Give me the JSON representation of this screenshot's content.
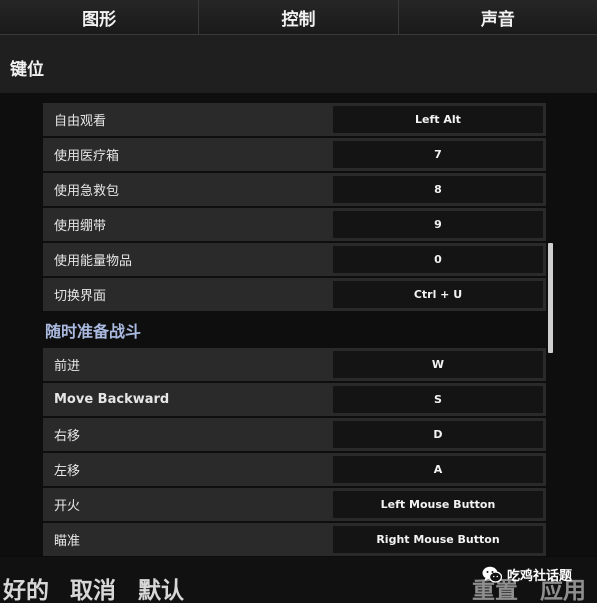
{
  "tabs": [
    {
      "label": "图形"
    },
    {
      "label": "控制"
    },
    {
      "label": "声音"
    }
  ],
  "section": {
    "title": "键位"
  },
  "rows_group1": [
    {
      "label": "自由观看",
      "key": "Left Alt"
    },
    {
      "label": "使用医疗箱",
      "key": "7"
    },
    {
      "label": "使用急救包",
      "key": "8"
    },
    {
      "label": "使用绷带",
      "key": "9"
    },
    {
      "label": "使用能量物品",
      "key": "0"
    },
    {
      "label": "切换界面",
      "key": "Ctrl + U"
    }
  ],
  "category": {
    "title": "随时准备战斗"
  },
  "rows_group2": [
    {
      "label": "前进",
      "key": "W"
    },
    {
      "label": "Move Backward",
      "key": "S"
    },
    {
      "label": "右移",
      "key": "D"
    },
    {
      "label": "左移",
      "key": "A"
    },
    {
      "label": "开火",
      "key": "Left Mouse Button"
    },
    {
      "label": "瞄准",
      "key": "Right Mouse Button"
    }
  ],
  "bottom": {
    "ok": "好的",
    "cancel": "取消",
    "default": "默认",
    "reset": "重置",
    "apply": "应用"
  },
  "watermark": {
    "text": "吃鸡社话题",
    "icon": "wechat-icon"
  }
}
